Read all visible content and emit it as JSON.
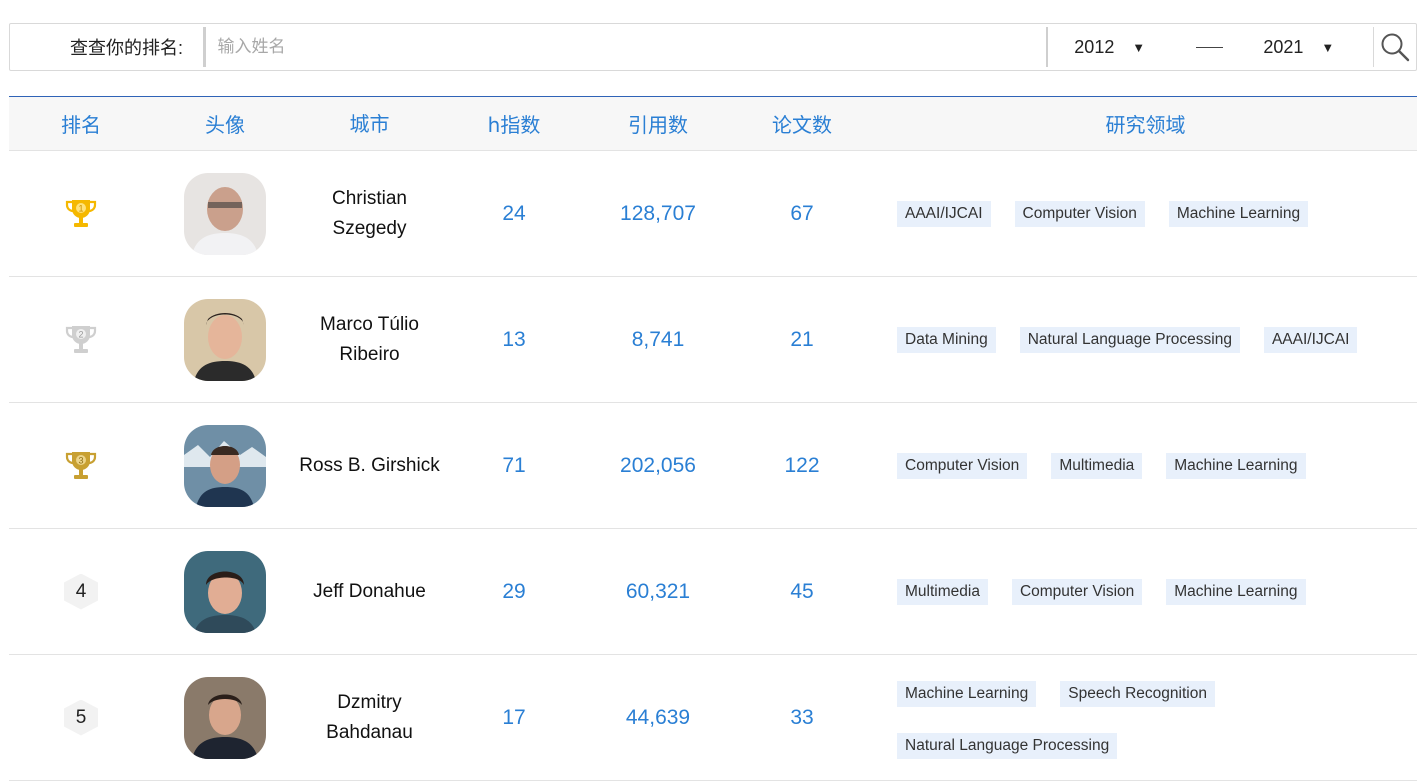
{
  "search": {
    "label": "查查你的排名:",
    "placeholder": "输入姓名",
    "from_year": "2012",
    "to_year": "2021"
  },
  "columns": [
    "排名",
    "头像",
    "城市",
    "h指数",
    "引用数",
    "论文数",
    "研究领域"
  ],
  "rows": [
    {
      "rank": "1",
      "badge": "gold",
      "name": [
        "Christian",
        "Szegedy"
      ],
      "h": "24",
      "citations": "128,707",
      "papers": "67",
      "fields": [
        "AAAI/IJCAI",
        "Computer Vision",
        "Machine Learning"
      ]
    },
    {
      "rank": "2",
      "badge": "silver",
      "name": [
        "Marco Túlio",
        "Ribeiro"
      ],
      "h": "13",
      "citations": "8,741",
      "papers": "21",
      "fields": [
        "Data Mining",
        "Natural Language Processing",
        "AAAI/IJCAI"
      ]
    },
    {
      "rank": "3",
      "badge": "bronze",
      "name": [
        "Ross B. Girshick"
      ],
      "h": "71",
      "citations": "202,056",
      "papers": "122",
      "fields": [
        "Computer Vision",
        "Multimedia",
        "Machine Learning"
      ]
    },
    {
      "rank": "4",
      "badge": "hex",
      "name": [
        "Jeff Donahue"
      ],
      "h": "29",
      "citations": "60,321",
      "papers": "45",
      "fields": [
        "Multimedia",
        "Computer Vision",
        "Machine Learning"
      ]
    },
    {
      "rank": "5",
      "badge": "hex",
      "name": [
        "Dzmitry",
        "Bahdanau"
      ],
      "h": "17",
      "citations": "44,639",
      "papers": "33",
      "fields": [
        "Machine Learning",
        "Speech Recognition",
        "Natural Language Processing"
      ]
    }
  ],
  "colors": {
    "accent": "#2a7fd4",
    "gold": "#f5b800",
    "silver": "#c9c9c9",
    "bronze": "#c8a032",
    "tag_bg": "#e8f0fb"
  },
  "icons": {
    "search": "magnifier-icon",
    "caret": "caret-down-icon"
  }
}
